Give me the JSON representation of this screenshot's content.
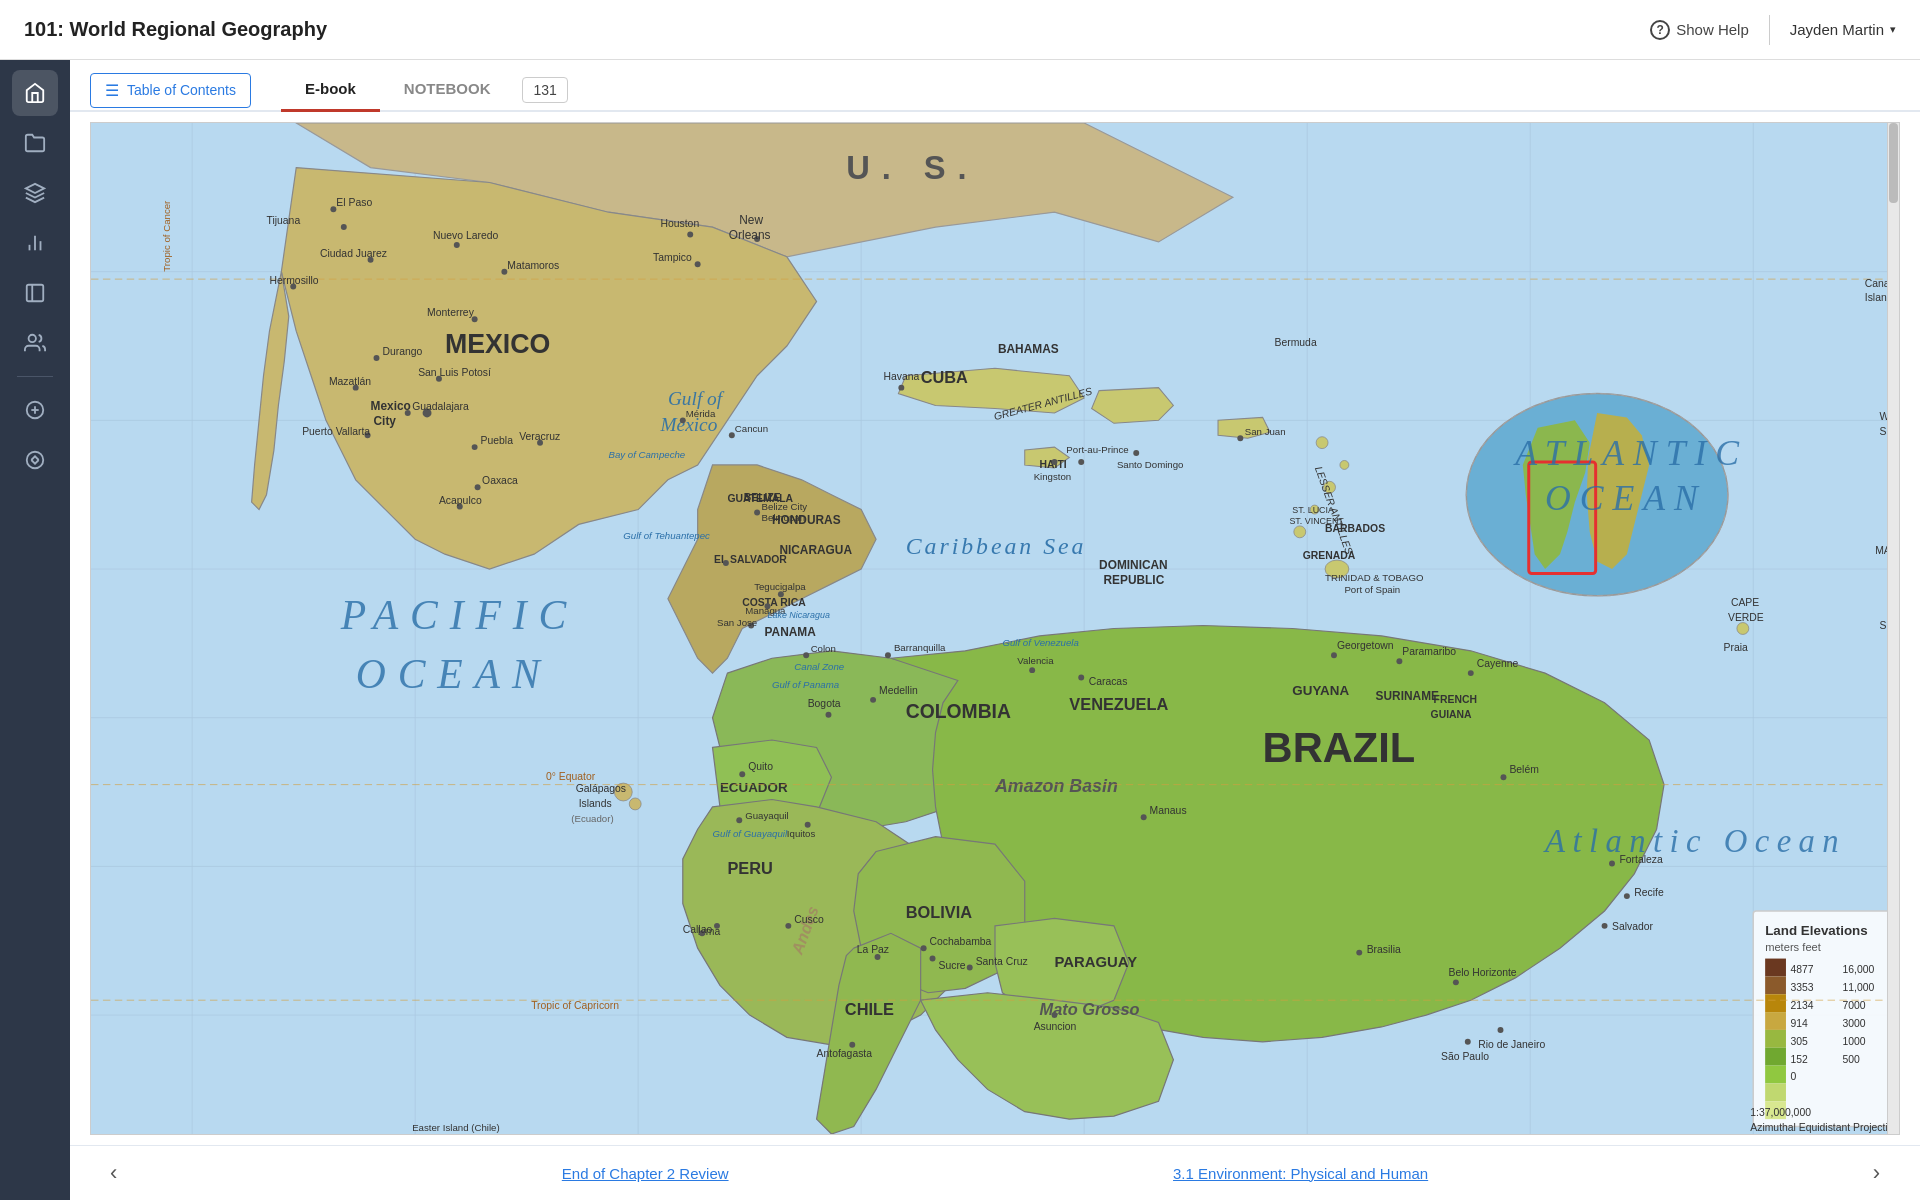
{
  "header": {
    "title": "101: World Regional Geography",
    "show_help_label": "Show Help",
    "user_name": "Jayden Martin"
  },
  "toc": {
    "label": "Table of Contents"
  },
  "tabs": [
    {
      "id": "ebook",
      "label": "E-book",
      "active": true
    },
    {
      "id": "notebook",
      "label": "NOTEBOOK",
      "active": false
    }
  ],
  "notebook_count": "131",
  "bottom_nav": {
    "prev_label": "End of Chapter 2 Review",
    "next_label": "3.1 Environment: Physical and Human"
  },
  "sidebar": {
    "items": [
      {
        "id": "home",
        "icon": "home"
      },
      {
        "id": "folder",
        "icon": "folder"
      },
      {
        "id": "layers",
        "icon": "layers"
      },
      {
        "id": "chart",
        "icon": "chart"
      },
      {
        "id": "notebook",
        "icon": "notebook"
      },
      {
        "id": "users",
        "icon": "users"
      },
      {
        "id": "add",
        "icon": "add"
      },
      {
        "id": "transfer",
        "icon": "transfer"
      }
    ]
  }
}
